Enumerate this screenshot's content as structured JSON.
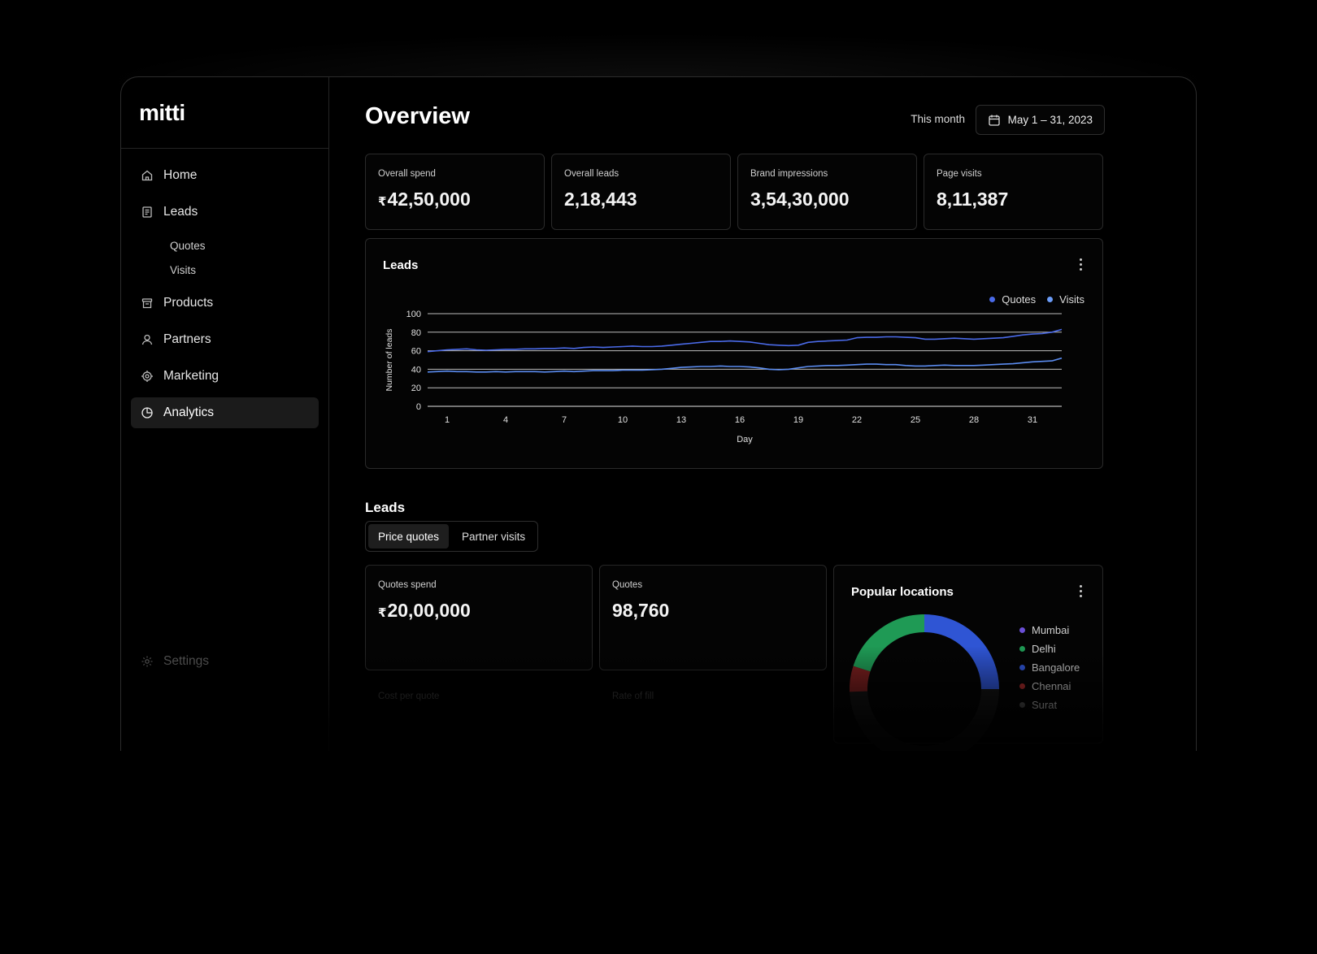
{
  "app": {
    "logo": "mitti"
  },
  "sidebar": {
    "items": [
      {
        "label": "Home",
        "icon": "home-icon"
      },
      {
        "label": "Leads",
        "icon": "document-icon"
      },
      {
        "label": "Products",
        "icon": "box-icon"
      },
      {
        "label": "Partners",
        "icon": "user-icon"
      },
      {
        "label": "Marketing",
        "icon": "target-icon"
      },
      {
        "label": "Analytics",
        "icon": "pie-chart-icon",
        "active": true
      }
    ],
    "leads_sub": [
      "Quotes",
      "Visits"
    ],
    "settings_label": "Settings"
  },
  "header": {
    "title": "Overview",
    "range_label": "This month",
    "date_range": "May 1 – 31, 2023"
  },
  "stats": [
    {
      "label": "Overall spend",
      "currency": "₹",
      "value": "42,50,000"
    },
    {
      "label": "Overall leads",
      "currency": "",
      "value": "2,18,443"
    },
    {
      "label": "Brand impressions",
      "currency": "",
      "value": "3,54,30,000"
    },
    {
      "label": "Page visits",
      "currency": "",
      "value": "8,11,387"
    }
  ],
  "leads_chart": {
    "title": "Leads"
  },
  "chart_data": {
    "type": "line",
    "title": "Leads",
    "xlabel": "Day",
    "ylabel": "Number of leads",
    "ylim": [
      0,
      100
    ],
    "xlim": [
      0,
      32.5
    ],
    "yticks": [
      0,
      20,
      40,
      60,
      80,
      100
    ],
    "xticks": [
      1,
      4,
      7,
      10,
      13,
      16,
      19,
      22,
      25,
      28,
      31
    ],
    "grid": true,
    "legend": "top-right",
    "x": [
      0,
      1,
      1.5,
      2,
      2.5,
      3,
      3.5,
      4,
      4.5,
      5,
      5.5,
      6,
      6.5,
      7,
      7.5,
      8,
      8.5,
      9,
      9.5,
      10,
      10.5,
      11,
      11.5,
      12,
      12.5,
      13,
      13.5,
      14,
      14.5,
      15,
      15.5,
      16,
      16.5,
      17,
      17.5,
      18,
      18.5,
      19,
      19.5,
      20,
      20.5,
      21,
      21.5,
      22,
      22.5,
      23,
      23.5,
      24,
      24.5,
      25,
      25.5,
      26,
      26.5,
      27,
      27.5,
      28,
      28.5,
      29,
      29.5,
      30,
      30.5,
      31,
      31.5,
      32,
      32.5
    ],
    "series": [
      {
        "name": "Quotes",
        "color": "#4a6ae8",
        "values": [
          59,
          61,
          61.5,
          62,
          61,
          60.5,
          61,
          61.5,
          61.5,
          62,
          62,
          62.5,
          62.5,
          63,
          62.5,
          63.5,
          64,
          63.5,
          64,
          64.5,
          65,
          64.5,
          64.5,
          65,
          66,
          67,
          68,
          69,
          70,
          70,
          70.5,
          70,
          69.5,
          68,
          66.5,
          66,
          65.5,
          66,
          69,
          70,
          70.5,
          71,
          71.5,
          74,
          74.5,
          74.5,
          75,
          75,
          74.5,
          74,
          72.5,
          72.5,
          73,
          73.5,
          73,
          72.5,
          73,
          73.5,
          74,
          75.5,
          77,
          78,
          78.5,
          80,
          83
        ]
      },
      {
        "name": "Visits",
        "color": "#5b8cf0",
        "values": [
          37,
          38,
          37.5,
          37.5,
          37,
          37,
          37.5,
          37,
          37.5,
          37.5,
          37.5,
          37,
          37.5,
          38,
          37.5,
          38,
          38.5,
          38.5,
          38.5,
          39,
          39,
          39,
          39.5,
          40,
          41,
          42,
          42.5,
          43,
          43,
          43.5,
          43,
          43,
          42.5,
          41.5,
          40,
          39.5,
          40,
          41.5,
          43,
          43.5,
          44,
          44,
          44.5,
          45,
          45.5,
          45.5,
          45,
          45,
          44,
          43.5,
          43.5,
          44,
          44.5,
          44,
          44,
          44,
          44.5,
          45,
          45.5,
          46,
          47,
          48,
          48.5,
          49,
          52
        ]
      }
    ]
  },
  "leads_section": {
    "title": "Leads",
    "tabs": [
      {
        "label": "Price quotes",
        "active": true
      },
      {
        "label": "Partner visits",
        "active": false
      }
    ],
    "cards": [
      {
        "label": "Quotes spend",
        "currency": "₹",
        "value": "20,00,000"
      },
      {
        "label": "Quotes",
        "currency": "",
        "value": "98,760"
      }
    ],
    "ghost_labels": [
      "Cost per quote",
      "Rate of fill"
    ]
  },
  "locations": {
    "title": "Popular locations",
    "items": [
      {
        "name": "Mumbai",
        "color": "#6a4fd6"
      },
      {
        "name": "Delhi",
        "color": "#1f9a55"
      },
      {
        "name": "Bangalore",
        "color": "#2f55d4"
      },
      {
        "name": "Chennai",
        "color": "#a52a2a"
      },
      {
        "name": "Surat",
        "color": "#555555"
      }
    ]
  }
}
